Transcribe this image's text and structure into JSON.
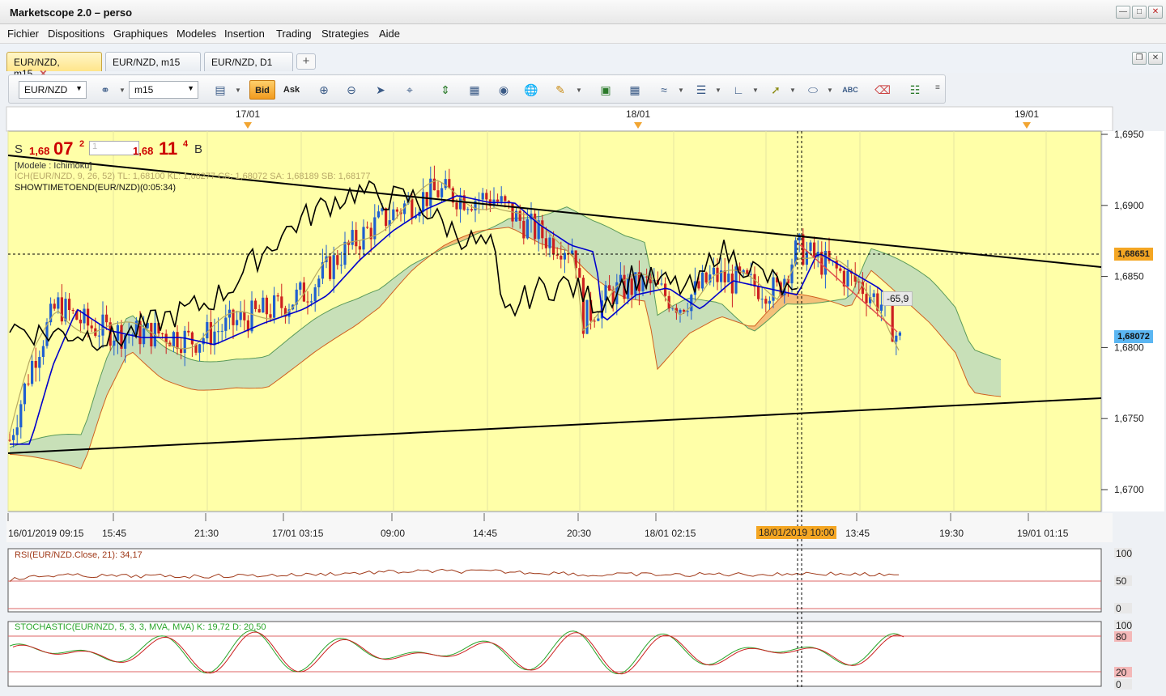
{
  "app": {
    "title": "Marketscope 2.0 – perso"
  },
  "menu": [
    "Fichier",
    "Dispositions",
    "Graphiques",
    "Modeles",
    "Insertion",
    "Trading",
    "Strategies",
    "Aide"
  ],
  "tabs": [
    {
      "label": "EUR/NZD, m15",
      "active": true,
      "close": "✕"
    },
    {
      "label": "EUR/NZD, m15",
      "active": false
    },
    {
      "label": "EUR/NZD, D1",
      "active": false
    }
  ],
  "toolbar": {
    "symbol": "EUR/NZD",
    "timeframe": "m15",
    "bid_label": "Bid",
    "ask_label": "Ask",
    "add_tab": "+"
  },
  "top_dates": [
    "17/01",
    "18/01",
    "19/01"
  ],
  "price_panel": {
    "sell_label": "S",
    "sell_prefix": "1,68",
    "sell_big": "07",
    "sell_sup": "2",
    "amount": "1",
    "buy_prefix": "1,68",
    "buy_big": "11",
    "buy_sup": "4",
    "buy_label": "B"
  },
  "indicators": {
    "model": "[Modele : Ichimoku]",
    "ichimoku": "ICH(EUR/NZD, 9, 26, 52)  TL: 1,68100  KL: 1,68277  CS: 1,68072  SA: 1,68189  SB: 1,68177",
    "showtime": "SHOWTIMETOEND(EUR/NZD)(0:05:34)",
    "rsi": "RSI(EUR/NZD.Close, 21): 34,17",
    "stoch": "STOCHASTIC(EUR/NZD, 5, 3, 3, MVA, MVA)  K: 19,72  D: 20,50"
  },
  "price_axis": [
    "1,6950",
    "1,6900",
    "1,6850",
    "1,6800",
    "1,6750",
    "1,6700"
  ],
  "price_tags": {
    "upper": "1,68651",
    "current": "1,68072"
  },
  "time_axis": [
    "16/01/2019 09:15",
    "15:45",
    "21:30",
    "17/01 03:15",
    "09:00",
    "14:45",
    "20:30",
    "18/01 02:15",
    "13:45",
    "19:30",
    "19/01 01:15"
  ],
  "date_flag": "18/01/2019 10:00",
  "pips_label": "-65,9",
  "rsi_axis": [
    "100",
    "50",
    "0"
  ],
  "stoch_axis": [
    "100",
    "80",
    "20",
    "0"
  ],
  "colors": {
    "chart_bg": "#ffffa8",
    "kijun": "#0000cc",
    "chikou": "#000000",
    "cloud_up": "#c8e0b8",
    "cloud_dn": "#f4c07a",
    "up_candle": "#1f5fd0",
    "down_candle": "#cc2020",
    "rsi": "#a03a1a",
    "stoch_k": "#2aa52a",
    "stoch_d": "#cc2020"
  }
}
